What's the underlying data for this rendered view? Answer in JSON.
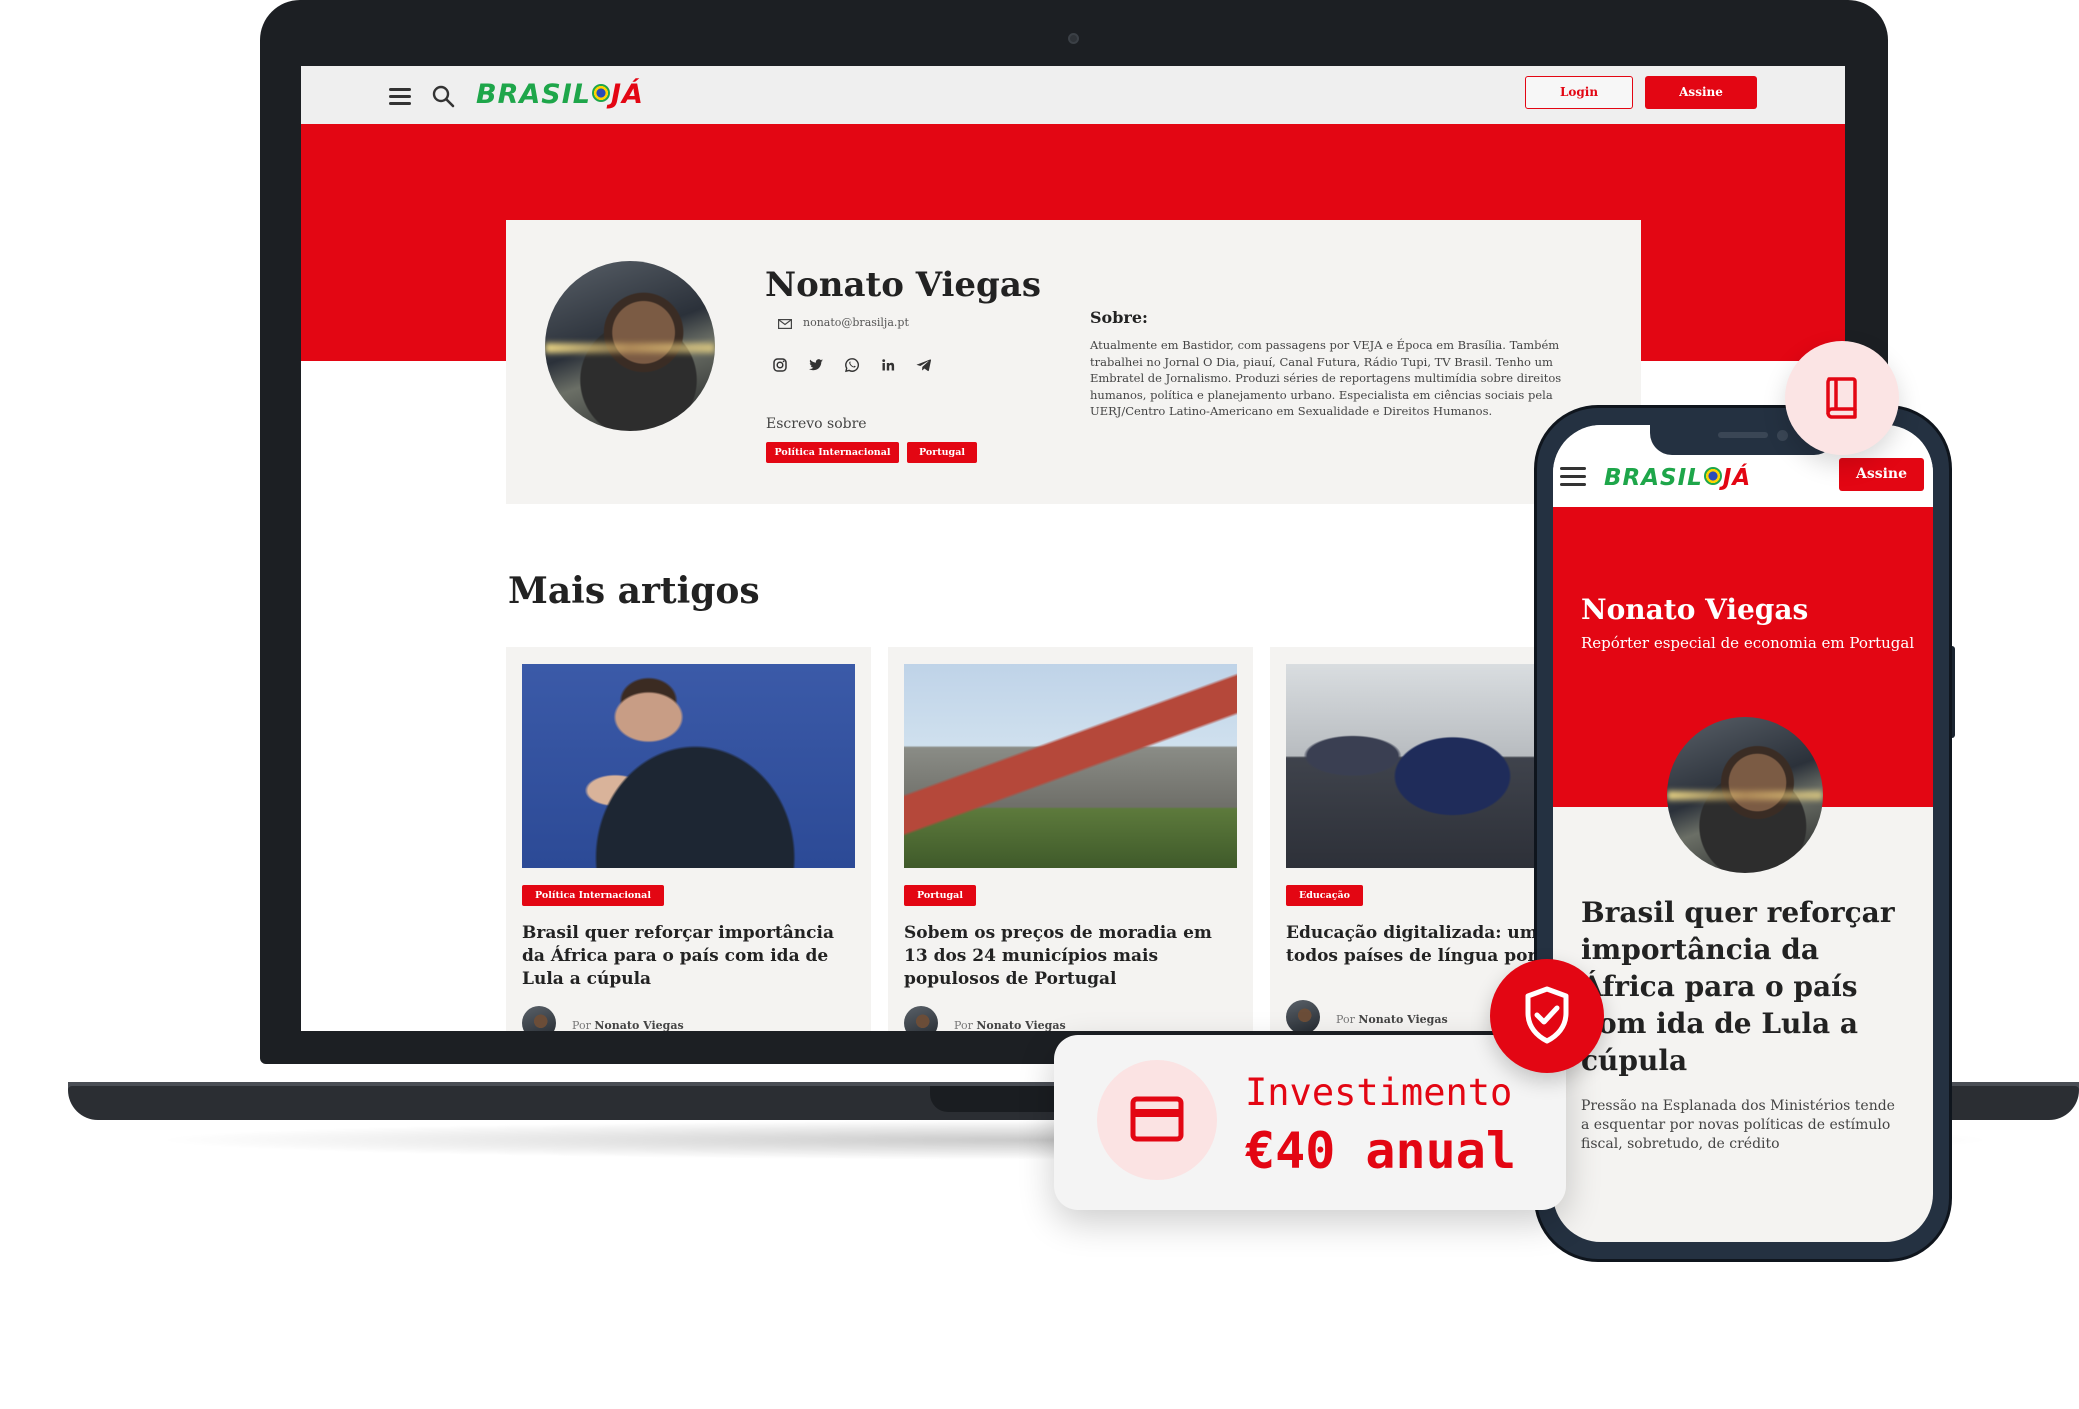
{
  "brand": {
    "logo_green": "BRASIL",
    "logo_red": "JÁ",
    "red": "#e30613",
    "green": "#1ea64a"
  },
  "desktop": {
    "header": {
      "login_label": "Login",
      "assine_label": "Assine"
    },
    "profile": {
      "name": "Nonato Viegas",
      "email": "nonato@brasilja.pt",
      "social_icons": [
        "instagram-icon",
        "twitter-icon",
        "whatsapp-icon",
        "linkedin-icon",
        "telegram-icon"
      ],
      "escrevo_label": "Escrevo sobre",
      "tags": [
        "Política Internacional",
        "Portugal"
      ],
      "sobre_heading": "Sobre:",
      "sobre_text": "Atualmente em Bastidor, com passagens por VEJA e Época em Brasília. Também trabalhei no Jornal O Dia, piauí, Canal Futura, Rádio Tupi, TV Brasil. Tenho um Embratel de Jornalismo. Produzi séries de reportagens multimídia sobre direitos humanos, política e planejamento urbano. Especialista em ciências sociais pela UERJ/Centro Latino-Americano em Sexualidade e Direitos Humanos."
    },
    "mais_artigos": "Mais artigos",
    "articles": [
      {
        "tag": "Política Internacional",
        "title": "Brasil quer reforçar importância da África para o país com ida de Lula a cúpula",
        "by": "Por",
        "author": "Nonato Viegas"
      },
      {
        "tag": "Portugal",
        "title": "Sobem os preços de moradia em 13 dos 24 municípios mais populosos de Portugal",
        "by": "Por",
        "author": "Nonato Viegas"
      },
      {
        "tag": "Educação",
        "title": "Educação digitalizada: um dos todos países de língua portug",
        "by": "Por",
        "author": "Nonato Viegas"
      }
    ]
  },
  "mobile": {
    "assine_label": "Assine",
    "name": "Nonato Viegas",
    "subtitle": "Repórter especial de economia em Portugal",
    "article_title": "Brasil quer reforçar importância da África para o país com ida de Lula a cúpula",
    "article_desc": "Pressão na Esplanada dos Ministérios tende a esquentar por novas políticas de estímulo fiscal, sobretudo, de crédito"
  },
  "badges": {
    "book_icon": "book-icon",
    "shield_icon": "shield-check-icon",
    "card_icon": "credit-card-icon",
    "invest_label": "Investimento",
    "invest_value": "€40 anual"
  }
}
